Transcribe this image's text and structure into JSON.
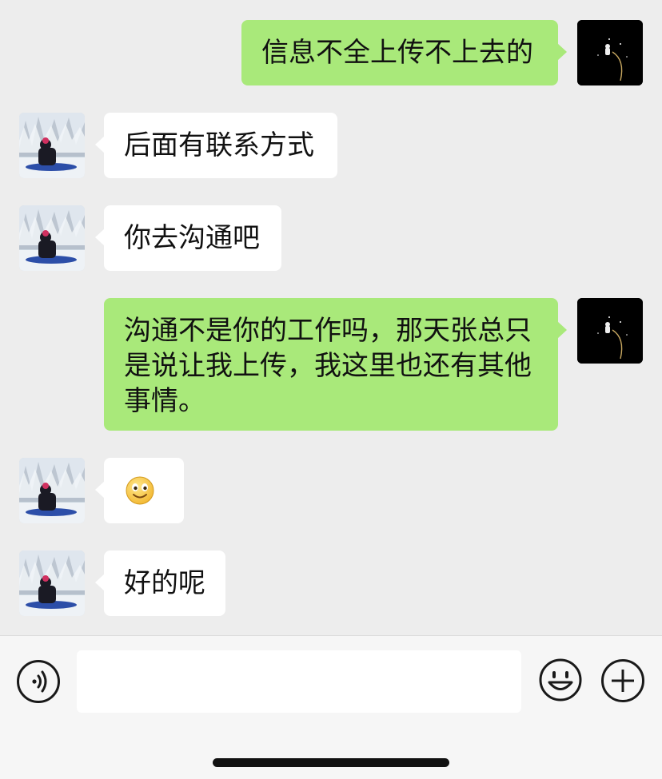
{
  "messages": [
    {
      "sender": "self",
      "text": "信息不全上传不上去的"
    },
    {
      "sender": "other",
      "text": "后面有联系方式"
    },
    {
      "sender": "other",
      "text": "你去沟通吧"
    },
    {
      "sender": "self",
      "lines": [
        "沟通不是你的工作吗，那天张总只",
        "是说让我上传，我这里也还有其他",
        "事情。"
      ]
    },
    {
      "sender": "other",
      "emoji": "smile-emoji"
    },
    {
      "sender": "other",
      "text": "好的呢"
    }
  ],
  "input": {
    "value": ""
  },
  "icons": {
    "voice": "voice-icon",
    "emoji": "emoji-icon",
    "plus": "plus-icon"
  },
  "colors": {
    "background": "#ededed",
    "self_bubble": "#a9e97a",
    "other_bubble": "#ffffff"
  }
}
